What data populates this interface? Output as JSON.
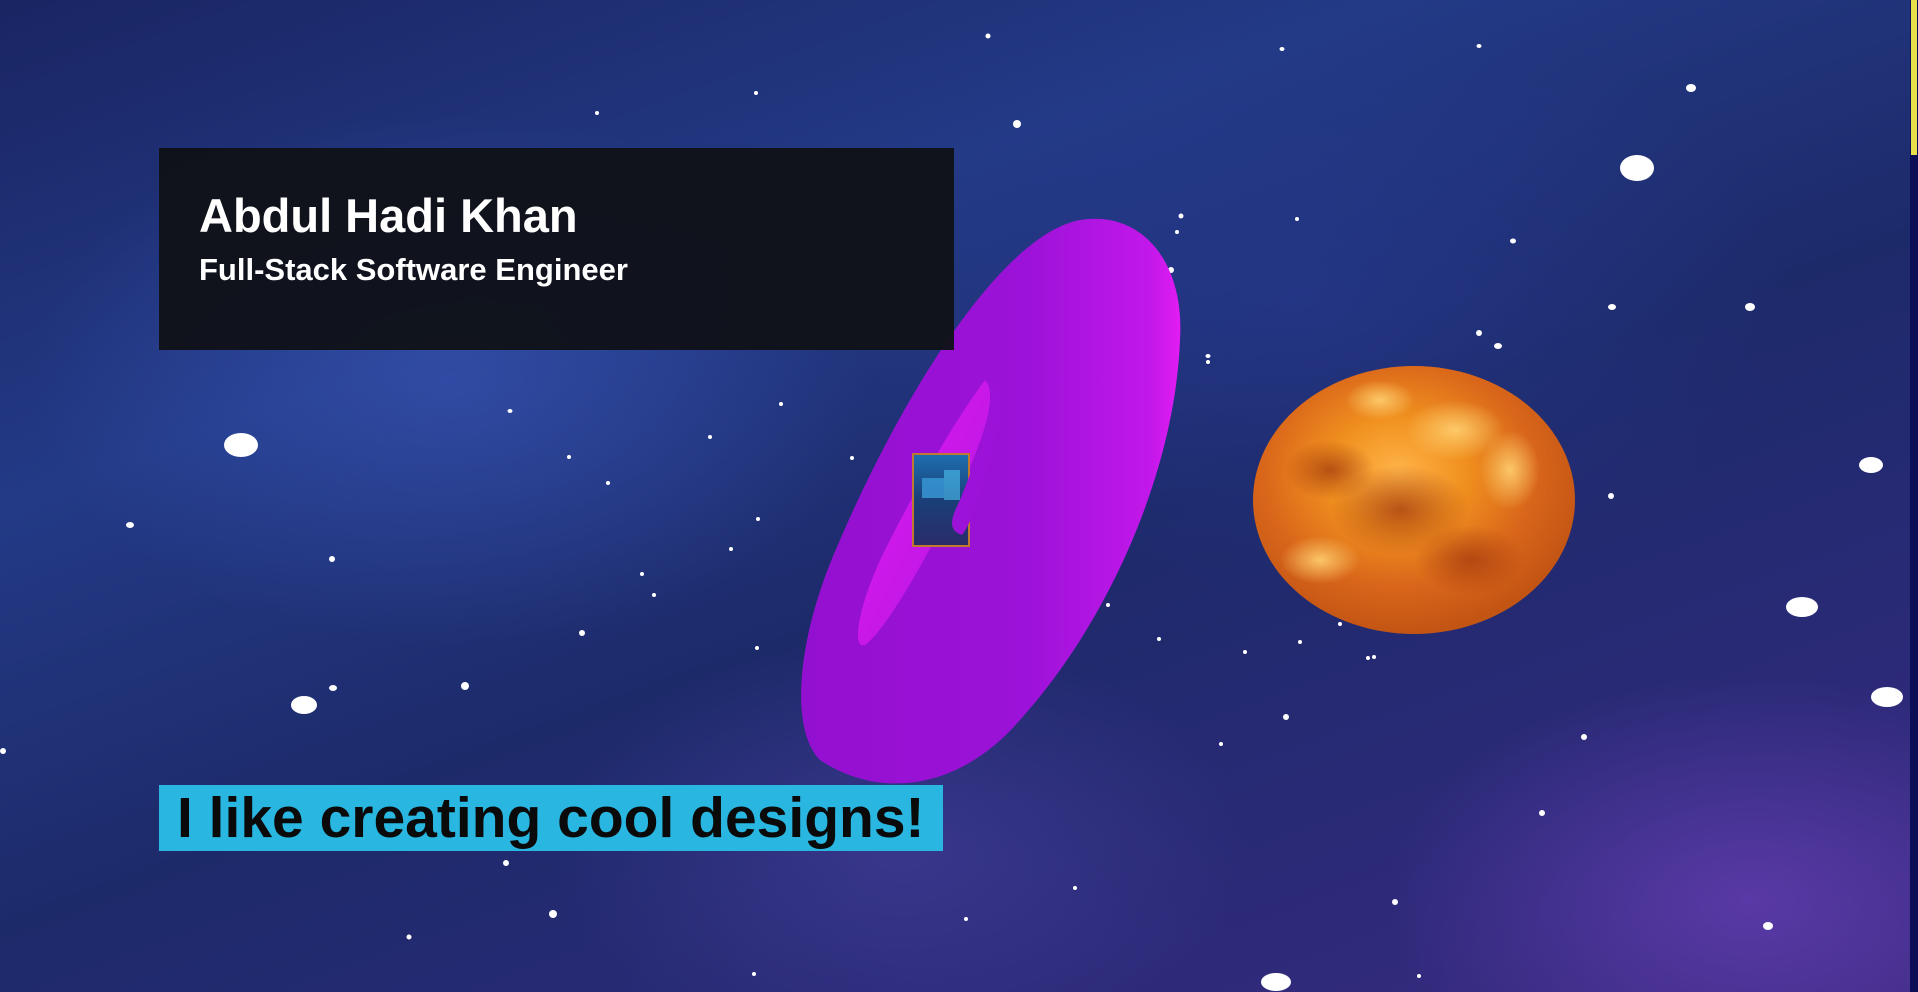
{
  "hero": {
    "name": "Abdul Hadi Khan",
    "role": "Full-Stack Software Engineer"
  },
  "tagline": "I like creating cool designs!",
  "colors": {
    "torus": "#9b12d6",
    "torus_highlight": "#e21cf2",
    "sun": "#e0761b",
    "tagline_bg": "#29b6e0",
    "card_bg": "#101218",
    "scroll_thumb": "#e8e04a"
  },
  "scene": {
    "objects": [
      "torus",
      "sun",
      "avatar-cube",
      "star-sprites"
    ]
  },
  "scroll": {
    "position": 0.0
  }
}
